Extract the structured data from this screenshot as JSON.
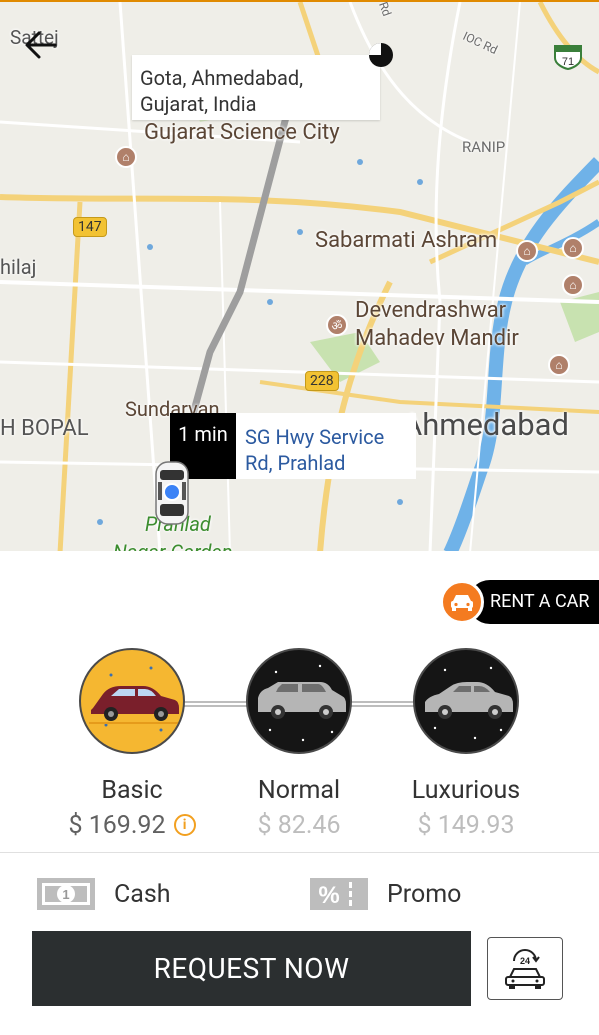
{
  "map": {
    "pickup_address": "Gota, Ahmedabad, Gujarat, India",
    "eta_label": "1 min",
    "destination_address": "SG Hwy Service Rd, Prahlad",
    "labels": [
      "Sattej",
      "Gujarat Science City",
      "RANIP",
      "Sabarmati Ashram",
      "hilaj",
      "Devendrashwar",
      "Mahadev Mandir",
      "Sundarvan",
      "H BOPAL",
      "Ahmedabad",
      "Prahlad",
      "Nagar Garden",
      "IOC Rd",
      "Rd"
    ],
    "route_shields": [
      "147",
      "228",
      "71"
    ]
  },
  "rent_car": {
    "label": "RENT A CAR"
  },
  "car_types": [
    {
      "name": "Basic",
      "price": "$ 169.92",
      "selected": true
    },
    {
      "name": "Normal",
      "price": "$ 82.46",
      "selected": false
    },
    {
      "name": "Luxurious",
      "price": "$ 149.93",
      "selected": false
    }
  ],
  "payment": {
    "label": "Cash"
  },
  "promo": {
    "label": "Promo"
  },
  "request_button": {
    "label": "REQUEST NOW"
  },
  "colors": {
    "accent_orange": "#f47b20",
    "selected_yellow": "#f5b731",
    "button_dark": "#2b2f30",
    "route_gray": "#9e9e9e"
  }
}
